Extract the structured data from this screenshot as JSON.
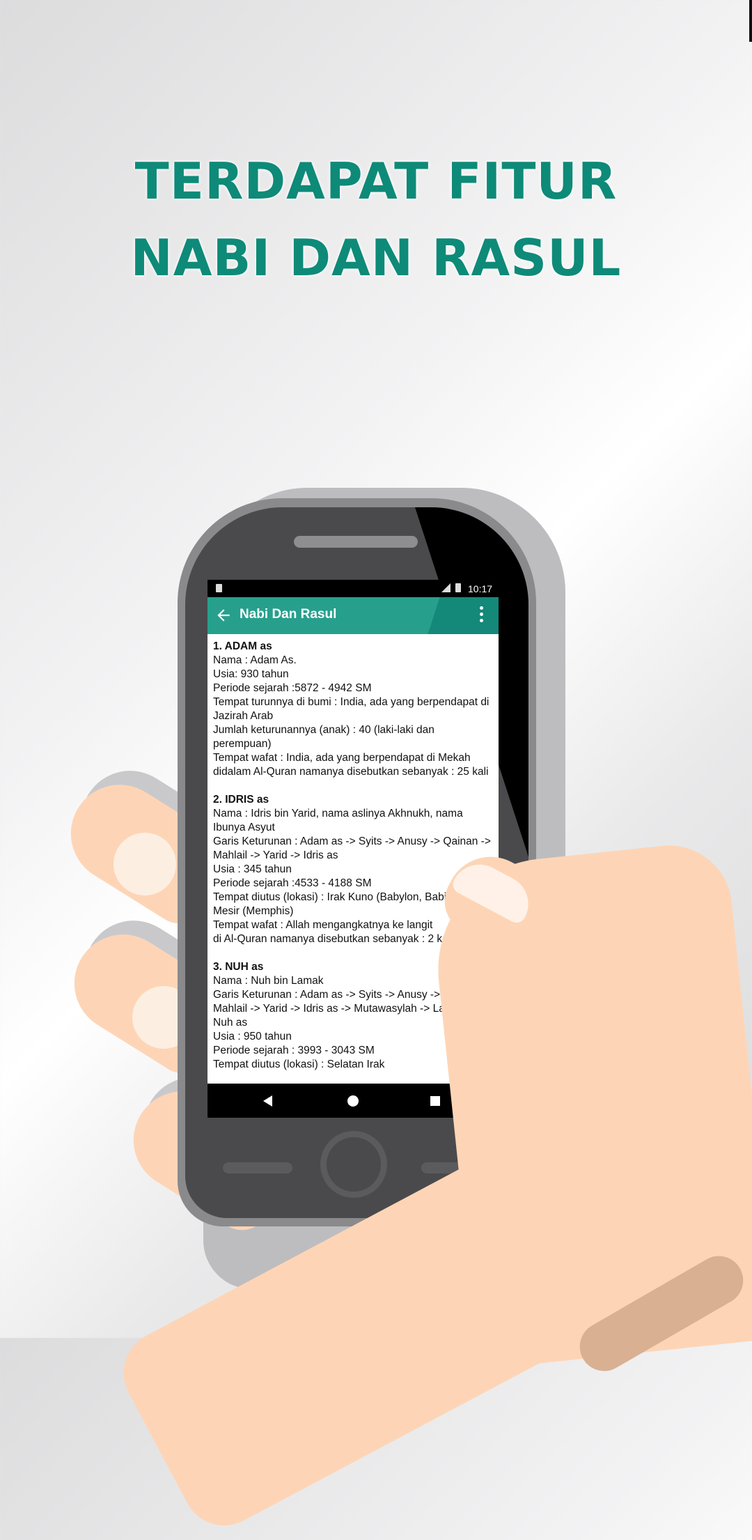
{
  "headline": {
    "line1": "TERDAPAT FITUR",
    "line2": "NABI DAN RASUL"
  },
  "status_bar": {
    "time": "10:17",
    "icons": [
      "sd-card-icon",
      "signal-icon",
      "battery-icon"
    ]
  },
  "app_bar": {
    "title": "Nabi Dan Rasul",
    "back_icon": "arrow-left-icon",
    "menu_icon": "more-vert-icon",
    "color": "#26a08d"
  },
  "entries": [
    {
      "title": "1. ADAM as",
      "lines": [
        "Nama     : Adam As.",
        "Usia: 930 tahun",
        "Periode sejarah :5872 - 4942 SM",
        "Tempat turunnya di bumi : India, ada yang berpendapat di Jazirah Arab",
        "Jumlah keturunannya (anak) :   40 (laki-laki dan perempuan)",
        "Tempat wafat : India, ada yang berpendapat di Mekah",
        "didalam Al-Quran namanya disebutkan sebanyak : 25 kali"
      ]
    },
    {
      "title": "2. IDRIS as",
      "lines": [
        "Nama     : Idris bin Yarid, nama aslinya Akhnukh, nama Ibunya Asyut",
        "Garis Keturunan : Adam as -> Syits -> Anusy -> Qainan -> Mahlail -> Yarid -> Idris as",
        "Usia : 345 tahun",
        "Periode sejarah :4533 - 4188 SM",
        "Tempat diutus (lokasi) :      Irak Kuno (Babylon, Babilonia) dan Mesir (Memphis)",
        "Tempat wafat : Allah mengangkatnya ke langit",
        "di Al-Quran namanya disebutkan sebanyak : 2 kali"
      ]
    },
    {
      "title": "3. NUH as",
      "lines": [
        "Nama     : Nuh bin Lamak",
        "Garis Keturunan : Adam as -> Syits -> Anusy -> Qainan -> Mahlail -> Yarid -> Idris as -> Mutawasylah -> Lamak -> Nuh as",
        "Usia : 950 tahun",
        "Periode sejarah : 3993 - 3043 SM",
        "Tempat diutus (lokasi) : Selatan Irak"
      ]
    }
  ],
  "nav_bar": {
    "icons": [
      "nav-back-icon",
      "nav-home-icon",
      "nav-recents-icon"
    ]
  }
}
